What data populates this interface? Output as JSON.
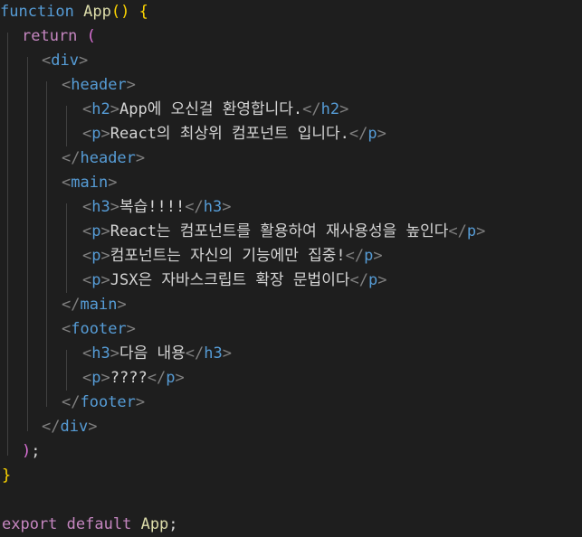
{
  "code": {
    "l1": {
      "kw": "function",
      "name": "App",
      "parens": "()",
      "brace": "{"
    },
    "l2": {
      "kw": "return",
      "paren": "("
    },
    "l3": {
      "tag": "div"
    },
    "l4": {
      "tag": "header"
    },
    "l5": {
      "tag": "h2",
      "text": "App에 오신걸 환영합니다."
    },
    "l6": {
      "tag": "p",
      "text": "React의 최상위 컴포넌트 입니다."
    },
    "l7": {
      "tag": "header"
    },
    "l8": {
      "tag": "main"
    },
    "l9": {
      "tag": "h3",
      "text": "복습!!!!"
    },
    "l10": {
      "tag": "p",
      "text": "React는 컴포넌트를 활용하여 재사용성을 높인다"
    },
    "l11": {
      "tag": "p",
      "text": "컴포넌트는 자신의 기능에만 집중!"
    },
    "l12": {
      "tag": "p",
      "text": "JSX은 자바스크립트 확장 문법이다"
    },
    "l13": {
      "tag": "main"
    },
    "l14": {
      "tag": "footer"
    },
    "l15": {
      "tag": "h3",
      "text": "다음 내용"
    },
    "l16": {
      "tag": "p",
      "text": "????"
    },
    "l17": {
      "tag": "footer"
    },
    "l18": {
      "tag": "div"
    },
    "l19": {
      "paren": ")",
      "semi": ";"
    },
    "l20": {
      "brace": "}"
    },
    "l22": {
      "kw1": "export",
      "kw2": "default",
      "name": "App",
      "semi": ";"
    }
  },
  "colors": {
    "background": "#1e1e1e",
    "keyword": "#569cd6",
    "control": "#c586c0",
    "function": "#dcdcaa",
    "bracket_gold": "#ffd700",
    "bracket_orchid": "#da70d6",
    "tag_punct": "#808080",
    "text": "#d4d4d4"
  }
}
